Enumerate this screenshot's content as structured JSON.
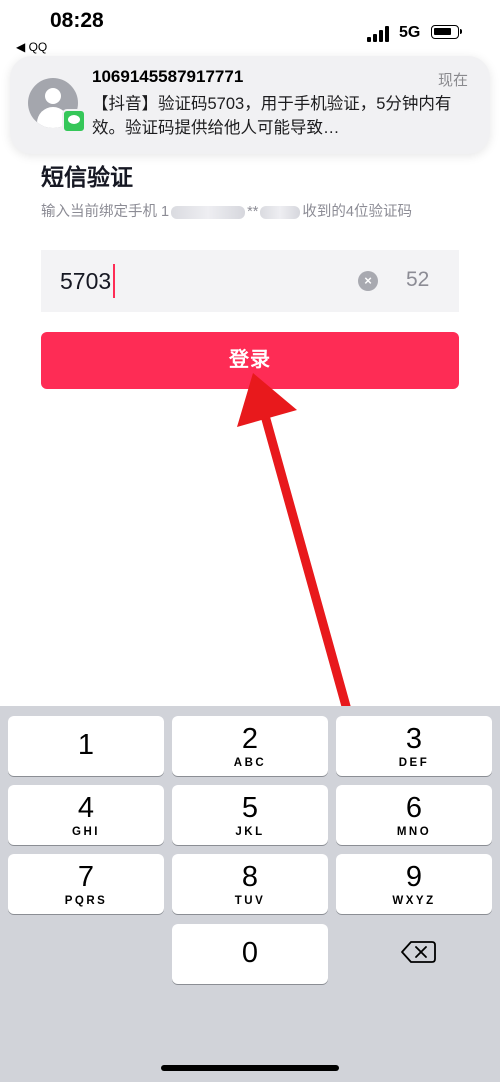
{
  "status_bar": {
    "time": "08:28",
    "back_app": "◀ QQ",
    "network": "5G"
  },
  "notification": {
    "sender": "1069145587917771",
    "time": "现在",
    "body": "【抖音】验证码5703，用于手机验证，5分钟内有效。验证码提供给他人可能导致…"
  },
  "page": {
    "title": "短信验证",
    "subtitle_prefix": "输入当前绑定手机 1",
    "subtitle_mask": "**",
    "subtitle_suffix": "收到的4位验证码",
    "code_value": "5703",
    "countdown": "52",
    "clear_icon": "×",
    "login_label": "登录"
  },
  "keyboard": {
    "keys": [
      {
        "digit": "1",
        "letters": ""
      },
      {
        "digit": "2",
        "letters": "ABC"
      },
      {
        "digit": "3",
        "letters": "DEF"
      },
      {
        "digit": "4",
        "letters": "GHI"
      },
      {
        "digit": "5",
        "letters": "JKL"
      },
      {
        "digit": "6",
        "letters": "MNO"
      },
      {
        "digit": "7",
        "letters": "PQRS"
      },
      {
        "digit": "8",
        "letters": "TUV"
      },
      {
        "digit": "9",
        "letters": "WXYZ"
      },
      {
        "digit": "0",
        "letters": ""
      }
    ]
  },
  "icons": {
    "notification_avatar": "person-icon",
    "messages_app": "messages-icon",
    "clear": "clear-circle-icon",
    "delete": "backspace-icon",
    "annotation": "red-arrow"
  },
  "colors": {
    "accent": "#fe2c55",
    "arrow": "#e8191c",
    "keyboard_bg": "#d1d3d9"
  }
}
